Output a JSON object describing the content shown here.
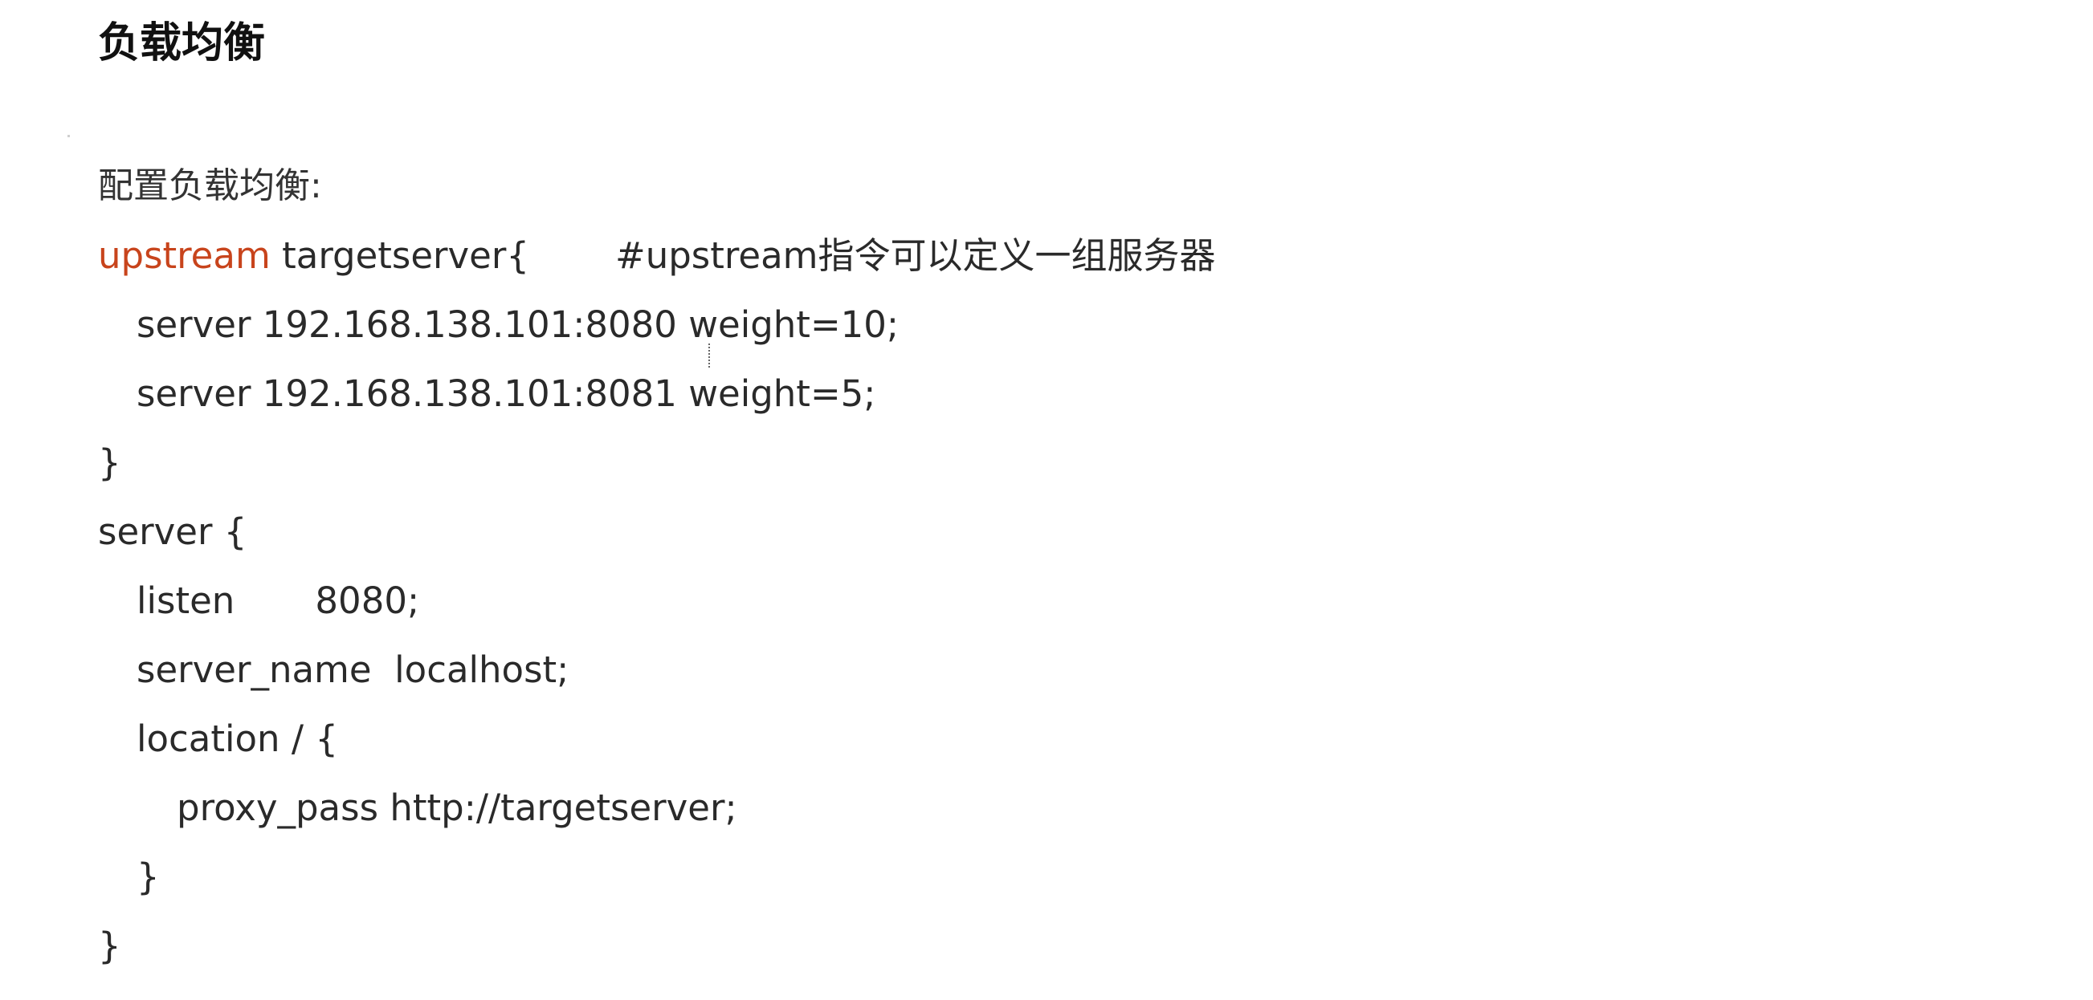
{
  "document": {
    "title": "负载均衡",
    "intro": "配置负载均衡:",
    "code": {
      "upstream_keyword": "upstream",
      "upstream_name": " targetserver{",
      "upstream_comment": "#upstream指令可以定义一组服务器",
      "server_line_1": "server 192.168.138.101:8080 weight=10;",
      "server_line_2": "server 192.168.138.101:8081 weight=5;",
      "close_upstream": "}",
      "server_block_open": "server {",
      "listen_line": "listen       8080;",
      "server_name_line": "server_name  localhost;",
      "location_open": "location / {",
      "proxy_pass_line": "proxy_pass http://targetserver;",
      "location_close": "}",
      "server_block_close": "}"
    }
  }
}
